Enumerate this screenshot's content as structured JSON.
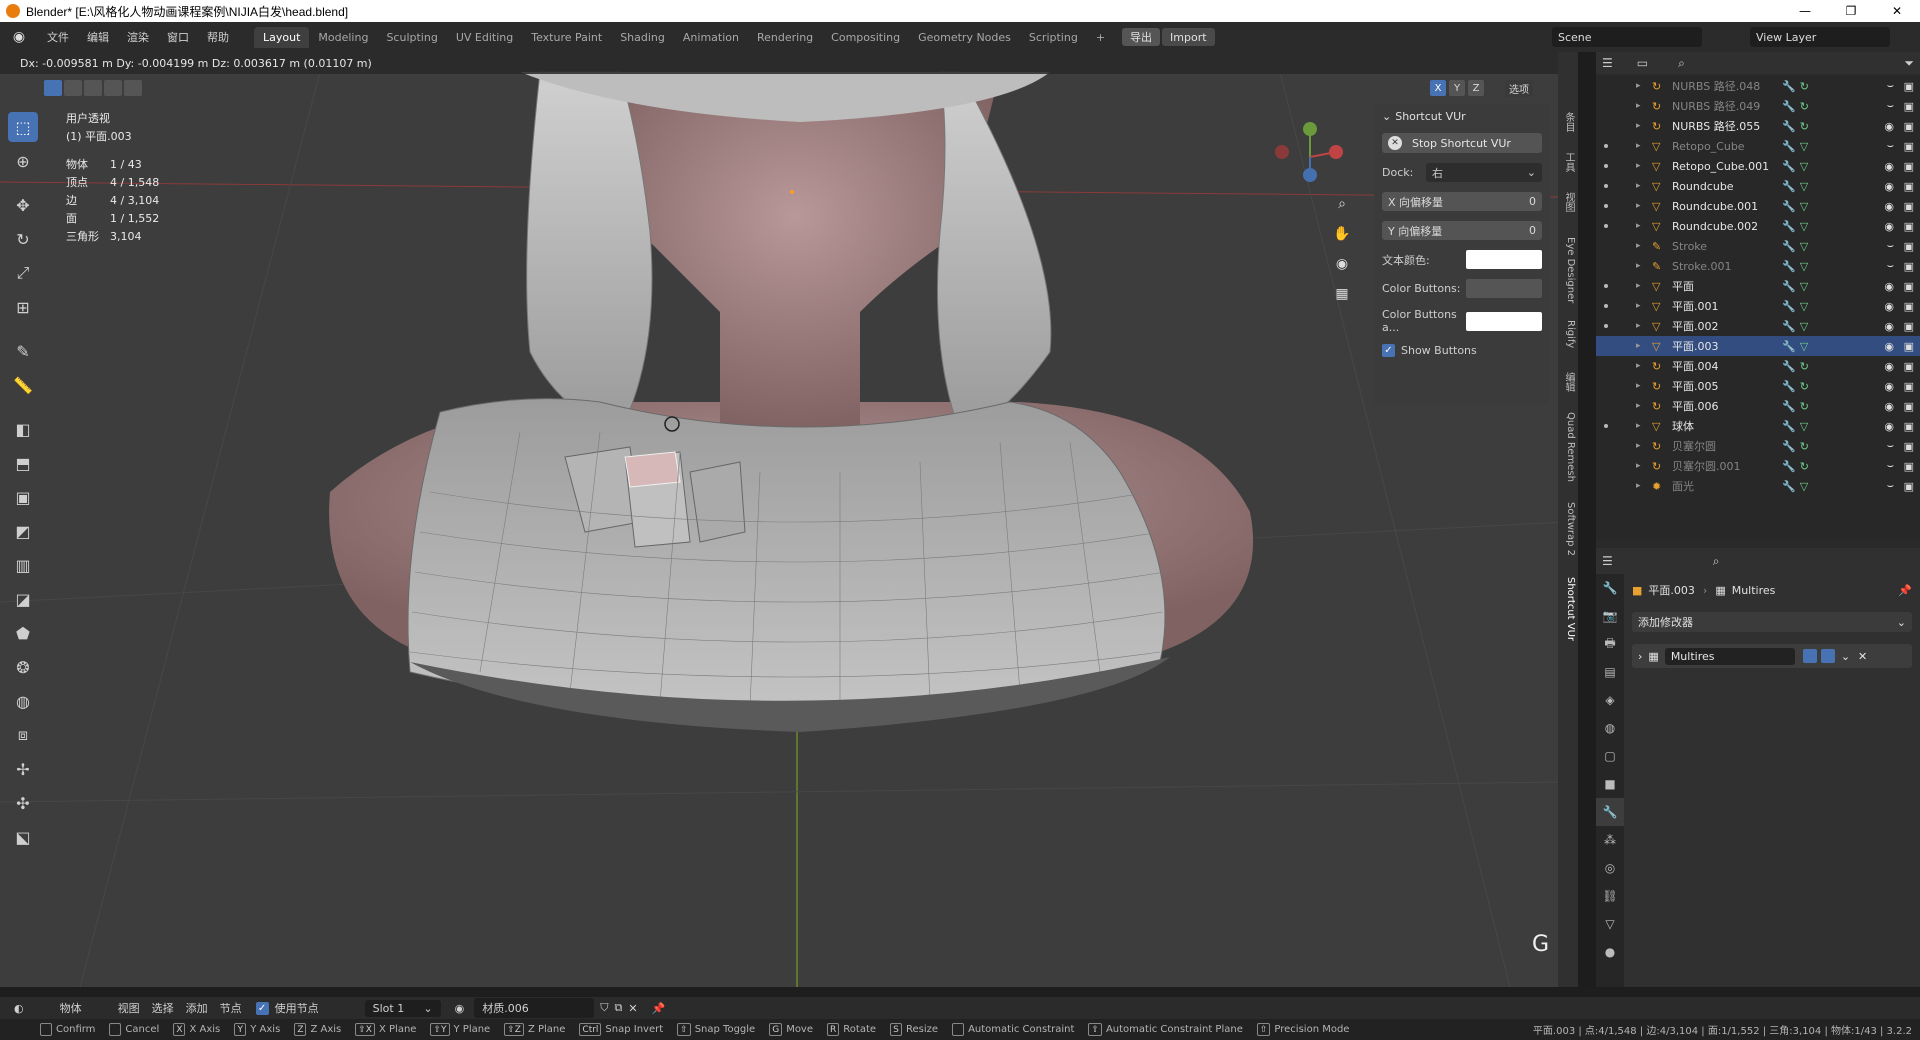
{
  "window": {
    "title": "Blender* [E:\\风格化人物动画课程案例\\NIJIA白发\\head.blend]",
    "controls": {
      "minimize": "—",
      "maximize": "❐",
      "close": "✕"
    }
  },
  "topbar": {
    "menus": [
      "文件",
      "编辑",
      "渲染",
      "窗口",
      "帮助"
    ],
    "workspaces": [
      "Layout",
      "Modeling",
      "Sculpting",
      "UV Editing",
      "Texture Paint",
      "Shading",
      "Animation",
      "Rendering",
      "Compositing",
      "Geometry Nodes",
      "Scripting"
    ],
    "active_workspace": "Layout",
    "add_workspace": "+",
    "export_label": "导出",
    "import_label": "Import",
    "scene": "Scene",
    "view_layer": "View Layer"
  },
  "viewport": {
    "header_text": "Dx: -0.009581 m  Dy: -0.004199 m  Dz: 0.003617 m (0.01107 m)",
    "view_name": "用户透视",
    "object_name": "(1) 平面.003",
    "stats": [
      {
        "label": "物体",
        "value": "1 / 43"
      },
      {
        "label": "顶点",
        "value": "4 / 1,548"
      },
      {
        "label": "边",
        "value": "4 / 3,104"
      },
      {
        "label": "面",
        "value": "1 / 1,552"
      },
      {
        "label": "三角形",
        "value": "3,104"
      }
    ],
    "axis_labels": {
      "x": "X",
      "y": "Y",
      "z": "Z"
    },
    "options_label": "选项",
    "key_overlay": "G",
    "tools": [
      "select-box",
      "cursor",
      "move",
      "rotate",
      "scale",
      "transform",
      "annotate",
      "measure",
      "add-cube",
      "extrude",
      "inset",
      "bevel",
      "loop-cut",
      "knife",
      "poly-build",
      "spin",
      "smooth",
      "edge-slide",
      "shrink-fatten",
      "shear",
      "rip"
    ]
  },
  "npanel": {
    "title": "Shortcut VUr",
    "stop_button": "Stop Shortcut VUr",
    "dock_label": "Dock:",
    "dock_value": "右",
    "x_offset_label": "X 向偏移量",
    "x_offset_value": "0",
    "y_offset_label": "Y 向偏移量",
    "y_offset_value": "0",
    "text_color_label": "文本颜色:",
    "color_buttons_label": "Color Buttons:",
    "color_buttons_a_label": "Color Buttons a...",
    "show_buttons_label": "Show Buttons",
    "text_color": "#ffffff",
    "color_buttons": "#555555",
    "color_buttons_a": "#ffffff"
  },
  "vtabs": [
    "条目",
    "工具",
    "视图",
    "Eye Designer",
    "Rigify",
    "编辑",
    "Quad Remesh",
    "Softwrap 2",
    "Shortcut VUr"
  ],
  "outliner": {
    "rows": [
      {
        "name": "NURBS 路径.048",
        "type": "curve",
        "dim": true,
        "dot": false
      },
      {
        "name": "NURBS 路径.049",
        "type": "curve",
        "dim": true,
        "dot": false
      },
      {
        "name": "NURBS 路径.055",
        "type": "curve",
        "dim": false,
        "dot": false
      },
      {
        "name": "Retopo_Cube",
        "type": "mesh",
        "dim": true,
        "dot": true
      },
      {
        "name": "Retopo_Cube.001",
        "type": "mesh",
        "dim": false,
        "dot": true
      },
      {
        "name": "Roundcube",
        "type": "mesh",
        "dim": false,
        "dot": true
      },
      {
        "name": "Roundcube.001",
        "type": "mesh",
        "dim": false,
        "dot": true
      },
      {
        "name": "Roundcube.002",
        "type": "mesh",
        "dim": false,
        "dot": true
      },
      {
        "name": "Stroke",
        "type": "gp",
        "dim": true,
        "dot": false
      },
      {
        "name": "Stroke.001",
        "type": "gp",
        "dim": true,
        "dot": false
      },
      {
        "name": "平面",
        "type": "mesh",
        "dim": false,
        "dot": true
      },
      {
        "name": "平面.001",
        "type": "mesh",
        "dim": false,
        "dot": true
      },
      {
        "name": "平面.002",
        "type": "mesh",
        "dim": false,
        "dot": true
      },
      {
        "name": "平面.003",
        "type": "mesh",
        "dim": false,
        "dot": false,
        "selected": true
      },
      {
        "name": "平面.004",
        "type": "curve",
        "dim": false,
        "dot": false
      },
      {
        "name": "平面.005",
        "type": "curve",
        "dim": false,
        "dot": false
      },
      {
        "name": "平面.006",
        "type": "curve",
        "dim": false,
        "dot": false
      },
      {
        "name": "球体",
        "type": "mesh",
        "dim": false,
        "dot": true
      },
      {
        "name": "贝塞尔圆",
        "type": "curve",
        "dim": true,
        "dot": false
      },
      {
        "name": "贝塞尔圆.001",
        "type": "curve",
        "dim": true,
        "dot": false
      },
      {
        "name": "面光",
        "type": "light",
        "dim": true,
        "dot": false
      }
    ]
  },
  "properties": {
    "breadcrumb_object": "平面.003",
    "breadcrumb_modifier": "Multires",
    "add_modifier_label": "添加修改器",
    "modifier_name": "Multires"
  },
  "bottombar": {
    "object_mode_label": "物体",
    "view_label": "视图",
    "select_label": "选择",
    "add_label": "添加",
    "node_label": "节点",
    "use_nodes_label": "使用节点",
    "slot_label": "Slot 1",
    "material_label": "材质.006"
  },
  "statusbar": {
    "hints": [
      {
        "key": "",
        "label": "Confirm"
      },
      {
        "key": "",
        "label": "Cancel"
      },
      {
        "key": "X",
        "label": "X Axis"
      },
      {
        "key": "Y",
        "label": "Y Axis"
      },
      {
        "key": "Z",
        "label": "Z Axis"
      },
      {
        "key": "⇧X",
        "label": "X Plane"
      },
      {
        "key": "⇧Y",
        "label": "Y Plane"
      },
      {
        "key": "⇧Z",
        "label": "Z Plane"
      },
      {
        "key": "Ctrl",
        "label": "Snap Invert"
      },
      {
        "key": "⇧",
        "label": "Snap Toggle"
      },
      {
        "key": "G",
        "label": "Move"
      },
      {
        "key": "R",
        "label": "Rotate"
      },
      {
        "key": "S",
        "label": "Resize"
      },
      {
        "key": "",
        "label": "Automatic Constraint"
      },
      {
        "key": "⇧",
        "label": "Automatic Constraint Plane"
      },
      {
        "key": "⇧",
        "label": "Precision Mode"
      }
    ],
    "info": "平面.003 | 点:4/1,548 | 边:4/3,104 | 面:1/1,552 | 三角:3,104 | 物体:1/43 | 3.2.2"
  }
}
